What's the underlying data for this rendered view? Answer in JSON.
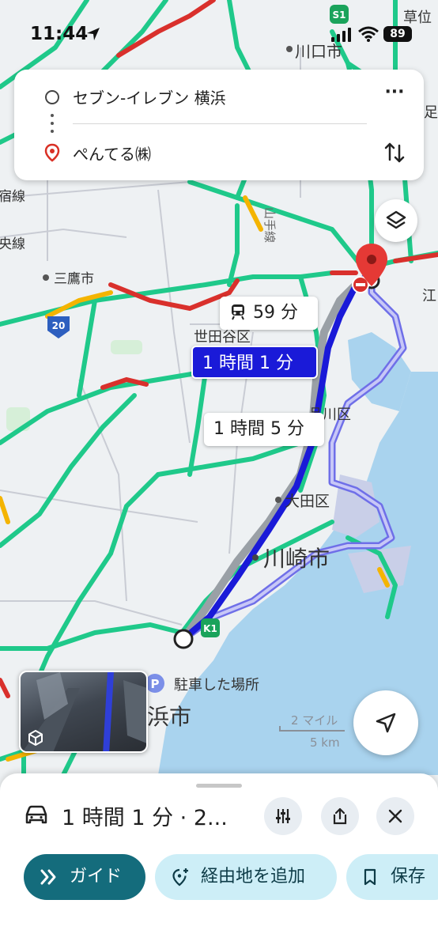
{
  "status_bar": {
    "time": "11:44",
    "battery": "89"
  },
  "directions": {
    "origin": "セブン-イレブン 横浜",
    "destination": "ぺんてる㈱"
  },
  "map": {
    "labels": {
      "kawaguchi": "川口市",
      "mitaka": "三鷹市",
      "setagaya": "世田谷区",
      "shinagawa": "品川区",
      "ota": "大田区",
      "kawasaki": "川崎市",
      "yokohama": "浜市",
      "parking": "駐車した場所",
      "scale_miles": "2 マイル",
      "scale_km": "5 km",
      "line_label_1": "宿線",
      "line_label_2": "央線",
      "yamanote": "山手線",
      "shield_s1": "S1",
      "shield_20": "20",
      "shield_k1": "K1",
      "edge_label_1": "草位",
      "edge_label_2": "足立",
      "edge_label_3": "江"
    }
  },
  "routes": {
    "transit_time": "59 分",
    "selected_time": "1 時間 1 分",
    "alt_time": "1 時間 5 分"
  },
  "sheet": {
    "summary": "1 時間 1 分 · 2...",
    "guide_label": "ガイド",
    "waypoint_label": "経由地を追加",
    "save_label": "保存"
  },
  "colors": {
    "route_selected": "#1a1ad8",
    "route_alt": "#8a8af0",
    "traffic_green": "#1fc98a",
    "traffic_red": "#d9302c",
    "traffic_yellow": "#f4b400",
    "water": "#a9d3ee",
    "accent": "#146c7c"
  }
}
